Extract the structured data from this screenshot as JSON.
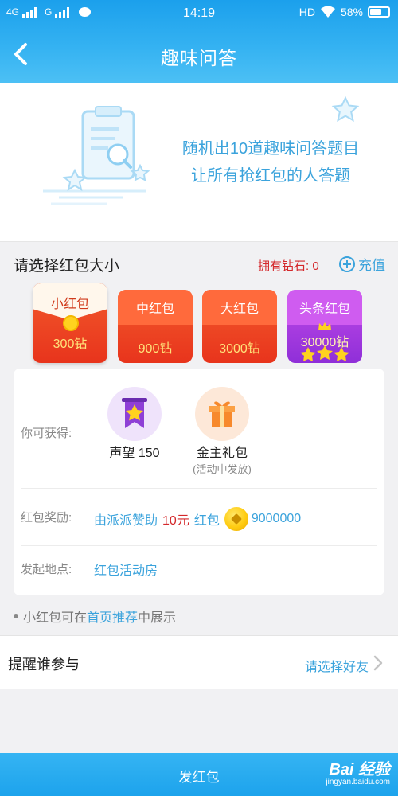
{
  "status_bar": {
    "network1": "4G",
    "network2": "G",
    "time": "14:19",
    "hd": "HD",
    "battery": "58%"
  },
  "header": {
    "title": "趣味问答"
  },
  "banner": {
    "line1": "随机出10道趣味问答题目",
    "line2": "让所有抢红包的人答题"
  },
  "choose": {
    "title": "请选择红包大小",
    "diamonds": "拥有钻石: 0",
    "recharge": "充值"
  },
  "envelopes": [
    {
      "name": "小红包",
      "price": "300钻",
      "selected": true
    },
    {
      "name": "中红包",
      "price": "900钻"
    },
    {
      "name": "大红包",
      "price": "3000钻"
    },
    {
      "name": "头条红包",
      "price": "30000钻"
    }
  ],
  "rewards": {
    "obtain_label": "你可获得:",
    "reputation": "声望 150",
    "gift_title": "金主礼包",
    "gift_note": "(活动中发放)",
    "bonus_label": "红包奖励:",
    "bonus_sponsor": "由派派赞助",
    "bonus_amount": "10元",
    "bonus_hb": "红包",
    "bonus_coins": "9000000",
    "place_label": "发起地点:",
    "place_value": "红包活动房"
  },
  "hint": {
    "prefix": "小红包可在",
    "link": "首页推荐",
    "suffix": "中展示"
  },
  "remind": {
    "title": "提醒谁参与",
    "action": "请选择好友"
  },
  "footer": {
    "send_label": "发红包",
    "watermark_logo": "Bai 经验",
    "watermark_url": "jingyan.baidu.com"
  },
  "colors": {
    "accent": "#3ba3dc",
    "header": "#1ba0ec",
    "red": "#d4282b",
    "envelope_red": "#e8341c",
    "envelope_purple": "#8f2fd8"
  }
}
